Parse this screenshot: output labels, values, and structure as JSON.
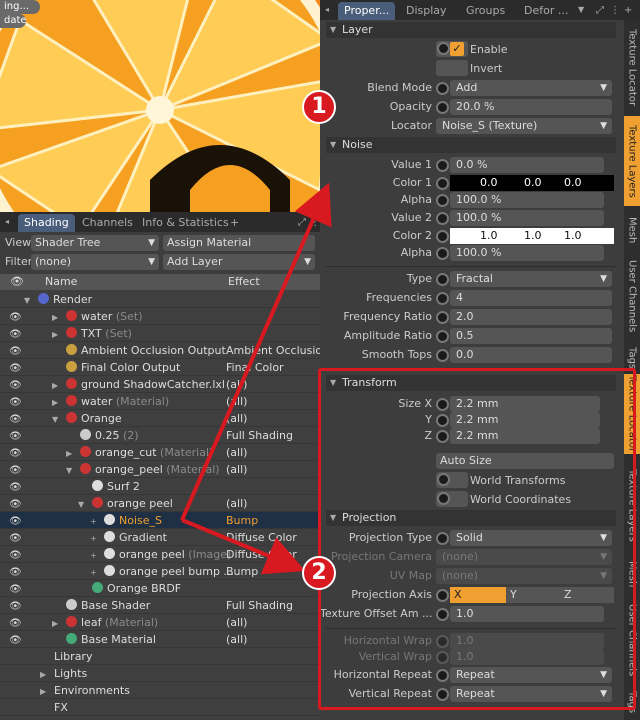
{
  "viewport": {
    "tag1": "ing...",
    "tag2": "date"
  },
  "shading": {
    "tabs": [
      "Shading",
      "Channels",
      "Info & Statistics",
      "+"
    ],
    "view_label": "View",
    "view_value": "Shader Tree",
    "assign_material": "Assign Material",
    "filter_label": "Filter",
    "filter_value": "(none)",
    "add_layer": "Add Layer",
    "col_name": "Name",
    "col_effect": "Effect",
    "rows": [
      {
        "name": "Render",
        "dim": "",
        "effect": ""
      },
      {
        "name": "water",
        "dim": "(Set)",
        "effect": ""
      },
      {
        "name": "TXT",
        "dim": "(Set)",
        "effect": ""
      },
      {
        "name": "Ambient Occlusion Output",
        "dim": "",
        "effect": "Ambient Occlusion"
      },
      {
        "name": "Final Color Output",
        "dim": "",
        "effect": "Final Color"
      },
      {
        "name": "ground ShadowCatcher.lxl",
        "dim": "",
        "effect": "(all)"
      },
      {
        "name": "water",
        "dim": "(Material)",
        "effect": "(all)"
      },
      {
        "name": "Orange",
        "dim": "",
        "effect": "(all)"
      },
      {
        "name": "0.25",
        "dim": "(2)",
        "effect": "Full Shading"
      },
      {
        "name": "orange_cut",
        "dim": "(Material)",
        "effect": "(all)"
      },
      {
        "name": "orange_peel",
        "dim": "(Material)",
        "effect": "(all)"
      },
      {
        "name": "Surf 2",
        "dim": "",
        "effect": ""
      },
      {
        "name": "orange peel",
        "dim": "",
        "effect": "(all)"
      },
      {
        "name": "Noise_S",
        "dim": "",
        "effect": "Bump"
      },
      {
        "name": "Gradient",
        "dim": "",
        "effect": "Diffuse Color"
      },
      {
        "name": "orange peel",
        "dim": "(Image)",
        "effect": "Diffuse Color"
      },
      {
        "name": "orange peel bump ...",
        "dim": "",
        "effect": "Bump"
      },
      {
        "name": "Orange BRDF",
        "dim": "",
        "effect": ""
      },
      {
        "name": "Base Shader",
        "dim": "",
        "effect": "Full Shading"
      },
      {
        "name": "leaf",
        "dim": "(Material)",
        "effect": "(all)"
      },
      {
        "name": "Base Material",
        "dim": "",
        "effect": "(all)"
      },
      {
        "name": "Library",
        "dim": "",
        "effect": ""
      },
      {
        "name": "Lights",
        "dim": "",
        "effect": ""
      },
      {
        "name": "Environments",
        "dim": "",
        "effect": ""
      },
      {
        "name": "FX",
        "dim": "",
        "effect": ""
      }
    ]
  },
  "props": {
    "tabs": [
      "Proper...",
      "Display",
      "Groups",
      "Defor ..."
    ],
    "vtabs_top": [
      "Texture Locator",
      "Texture Layers",
      "Mesh",
      "User Channels",
      "Tags"
    ],
    "vtabs_bottom": [
      "Texture Locator",
      "Texture Layers",
      "Mesh",
      "User Channels",
      "Tags"
    ],
    "layer": {
      "title": "Layer",
      "enable": "Enable",
      "invert": "Invert",
      "blend_label": "Blend Mode",
      "blend": "Add",
      "opacity_label": "Opacity",
      "opacity": "20.0 %",
      "locator_label": "Locator",
      "locator": "Noise_S (Texture)"
    },
    "noise": {
      "title": "Noise",
      "value1_label": "Value 1",
      "value1": "0.0 %",
      "color1_label": "Color 1",
      "color1": [
        "0.0",
        "0.0",
        "0.0"
      ],
      "alpha1_label": "Alpha",
      "alpha1": "100.0 %",
      "value2_label": "Value 2",
      "value2": "100.0 %",
      "color2_label": "Color 2",
      "color2": [
        "1.0",
        "1.0",
        "1.0"
      ],
      "alpha2_label": "Alpha",
      "alpha2": "100.0 %",
      "type_label": "Type",
      "type": "Fractal",
      "freq_label": "Frequencies",
      "freq": "4",
      "fratio_label": "Frequency Ratio",
      "fratio": "2.0",
      "aratio_label": "Amplitude Ratio",
      "aratio": "0.5",
      "smooth_label": "Smooth Tops",
      "smooth": "0.0"
    },
    "transform": {
      "title": "Transform",
      "sizex_label": "Size X",
      "y_label": "Y",
      "z_label": "Z",
      "sx": "2.2 mm",
      "sy": "2.2 mm",
      "sz": "2.2 mm",
      "auto_size": "Auto Size",
      "world_transforms": "World Transforms",
      "world_coords": "World Coordinates"
    },
    "projection": {
      "title": "Projection",
      "ptype_label": "Projection Type",
      "ptype": "Solid",
      "pcam_label": "Projection Camera",
      "pcam": "(none)",
      "uv_label": "UV Map",
      "uv": "(none)",
      "axis_label": "Projection Axis",
      "axis": [
        "X",
        "Y",
        "Z"
      ],
      "offset_label": "Texture Offset Am ...",
      "offset": "1.0",
      "hwrap_label": "Horizontal Wrap",
      "hwrap": "1.0",
      "vwrap_label": "Vertical Wrap",
      "vwrap": "1.0",
      "hrep_label": "Horizontal Repeat",
      "hrep": "Repeat",
      "vrep_label": "Vertical Repeat",
      "vrep": "Repeat"
    }
  },
  "markers": [
    "1",
    "2"
  ],
  "accent": "#f0a030",
  "annotation_color": "#d91920"
}
